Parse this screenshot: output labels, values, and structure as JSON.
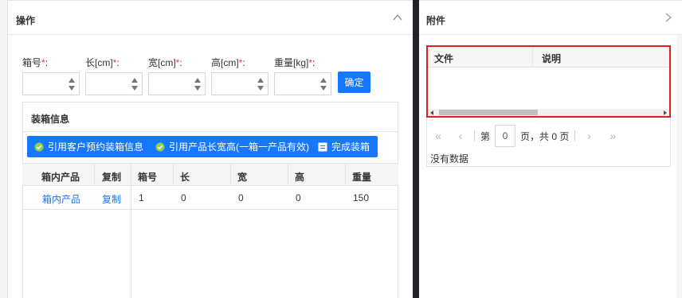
{
  "left_panel": {
    "title": "操作"
  },
  "form": {
    "fields": [
      {
        "label": "箱号",
        "required_mark": "*",
        "suffix": ":",
        "value": ""
      },
      {
        "label": "长[cm]",
        "required_mark": "*",
        "suffix": ":",
        "value": ""
      },
      {
        "label": "宽[cm]",
        "required_mark": "*",
        "suffix": ":",
        "value": ""
      },
      {
        "label": "高[cm]",
        "required_mark": "*",
        "suffix": ":",
        "value": ""
      },
      {
        "label": "重量[kg]",
        "required_mark": "*",
        "suffix": ":",
        "value": ""
      }
    ],
    "confirm_label": "确定"
  },
  "packing": {
    "title": "装箱信息",
    "buttons": {
      "ref_customer": "引用客户预约装箱信息",
      "ref_product": "引用产品长宽高(一箱一产品有效)",
      "complete": "完成装箱"
    },
    "left_columns": [
      "箱内产品",
      "复制"
    ],
    "right_columns": [
      "箱号",
      "长",
      "宽",
      "高",
      "重量"
    ],
    "rows": [
      {
        "product_link": "箱内产品",
        "copy_link": "复制",
        "box_no": "1",
        "length": "0",
        "width": "0",
        "height": "0",
        "weight": "150"
      }
    ]
  },
  "attachments": {
    "title": "附件",
    "columns": [
      "文件",
      "说明"
    ],
    "pager": {
      "page_prefix": "第",
      "current_page": "0",
      "page_suffix": "页，共 0 页"
    },
    "empty_text": "没有数据"
  },
  "colors": {
    "accent": "#1677ff",
    "highlight_border": "#e02020",
    "divider": "#1f2328"
  }
}
